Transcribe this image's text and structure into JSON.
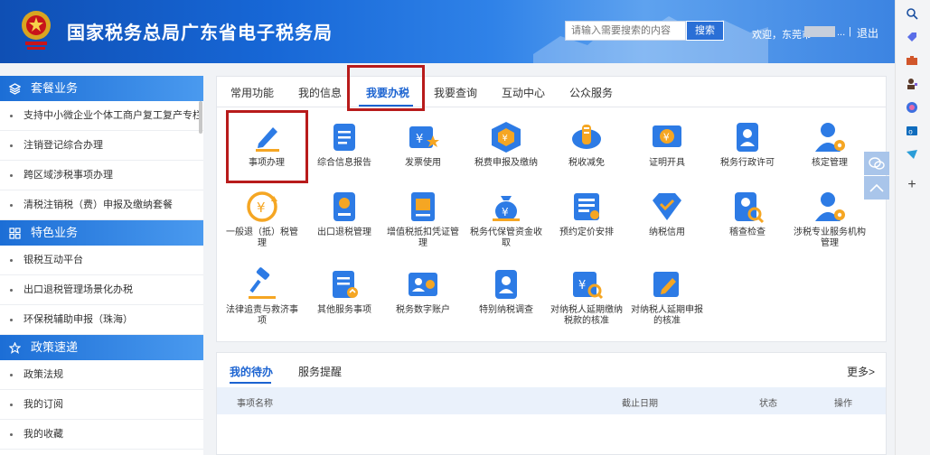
{
  "header": {
    "site_title": "国家税务总局广东省电子税务局",
    "search_placeholder": "请输入需要搜索的内容",
    "search_button": "搜索",
    "welcome": "欢迎，东莞市",
    "welcome_tail": "...",
    "separator": "|",
    "logout": "退出"
  },
  "sidebar": {
    "sections": [
      {
        "title": "套餐业务",
        "items": [
          "支持中小微企业个体工商户复工复产专栏",
          "注销登记综合办理",
          "跨区域涉税事项办理",
          "清税注销税（费）申报及缴纳套餐"
        ]
      },
      {
        "title": "特色业务",
        "items": [
          "银税互动平台",
          "出口退税管理场景化办税",
          "环保税辅助申报（珠海）"
        ]
      },
      {
        "title": "政策速递",
        "items": [
          "政策法规",
          "我的订阅",
          "我的收藏"
        ]
      }
    ]
  },
  "tabs": [
    "常用功能",
    "我的信息",
    "我要办税",
    "我要查询",
    "互动中心",
    "公众服务"
  ],
  "active_tab": "我要办税",
  "services": [
    {
      "label": "事项办理",
      "icon": "pencil-icon"
    },
    {
      "label": "综合信息报告",
      "icon": "report-icon"
    },
    {
      "label": "发票使用",
      "icon": "invoice-icon"
    },
    {
      "label": "税费申报及缴纳",
      "icon": "tax-declare-icon"
    },
    {
      "label": "税收减免",
      "icon": "coins-icon"
    },
    {
      "label": "证明开具",
      "icon": "certificate-icon"
    },
    {
      "label": "税务行政许可",
      "icon": "license-icon"
    },
    {
      "label": "核定管理",
      "icon": "user-gear-icon"
    },
    {
      "label": "一般退（抵）税管理",
      "icon": "refund-icon"
    },
    {
      "label": "出口退税管理",
      "icon": "export-refund-icon"
    },
    {
      "label": "增值税抵扣凭证管理",
      "icon": "vat-ticket-icon"
    },
    {
      "label": "税务代保管资金收取",
      "icon": "money-bag-icon"
    },
    {
      "label": "预约定价安排",
      "icon": "pricing-doc-icon"
    },
    {
      "label": "纳税信用",
      "icon": "credit-shield-icon"
    },
    {
      "label": "稽查检查",
      "icon": "inspect-icon"
    },
    {
      "label": "涉税专业服务机构管理",
      "icon": "agency-icon"
    },
    {
      "label": "法律追责与救济事项",
      "icon": "gavel-icon"
    },
    {
      "label": "其他服务事项",
      "icon": "clipboard-icon"
    },
    {
      "label": "税务数字账户",
      "icon": "digital-account-icon"
    },
    {
      "label": "特别纳税调查",
      "icon": "special-tax-icon"
    },
    {
      "label": "对纳税人延期缴纳税款的核准",
      "icon": "delay-pay-icon"
    },
    {
      "label": "对纳税人延期申报的核准",
      "icon": "delay-declare-icon"
    }
  ],
  "todo": {
    "tabs": [
      "我的待办",
      "服务提醒"
    ],
    "more": "更多>",
    "columns": [
      "事项名称",
      "截止日期",
      "状态",
      "操作"
    ]
  },
  "colors": {
    "brand": "#1b63d1",
    "highlight": "#b81b1b",
    "icon_blue": "#2d7be5",
    "icon_orange": "#f5a623"
  }
}
